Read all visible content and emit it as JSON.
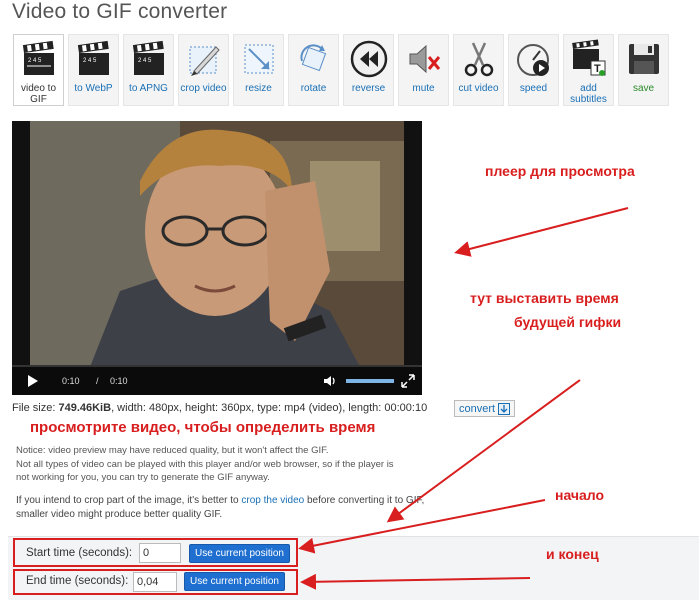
{
  "page": {
    "title": "Video to GIF converter"
  },
  "toolbar": {
    "items": [
      {
        "label": "video to GIF",
        "icon": "clapperboard-icon",
        "active": true
      },
      {
        "label": "to WebP",
        "icon": "clapperboard-icon"
      },
      {
        "label": "to APNG",
        "icon": "clapperboard-icon"
      },
      {
        "label": "crop video",
        "icon": "crop-icon"
      },
      {
        "label": "resize",
        "icon": "resize-icon"
      },
      {
        "label": "rotate",
        "icon": "rotate-icon"
      },
      {
        "label": "reverse",
        "icon": "reverse-icon"
      },
      {
        "label": "mute",
        "icon": "mute-icon"
      },
      {
        "label": "cut video",
        "icon": "scissors-icon"
      },
      {
        "label": "speed",
        "icon": "speed-icon"
      },
      {
        "label": "add subtitles",
        "icon": "subtitles-icon"
      },
      {
        "label": "save",
        "icon": "save-icon"
      }
    ]
  },
  "player": {
    "current_time": "0:10",
    "separator": "/",
    "duration": "0:10"
  },
  "file_info": {
    "prefix": "File size: ",
    "size": "749.46KiB",
    "details": ", width: 480px, height: 360px, type: mp4 (video), length: 00:00:10",
    "convert_label": "convert"
  },
  "notice": {
    "line1": "Notice: video preview may have reduced quality, but it won't affect the GIF.",
    "line2": "Not all types of video can be played with this player and/or web browser, so if the player is",
    "line3": "not working for you, you can try to generate the GIF anyway."
  },
  "crop_hint": {
    "before": "If you intend to crop part of the image, it's better to ",
    "link": "crop the video",
    "after": " before converting it to GIF, smaller video might produce better quality GIF."
  },
  "time_form": {
    "start_label": "Start time (seconds):",
    "start_value": "0",
    "end_label": "End time (seconds):",
    "end_value": "0,04",
    "button_label": "Use current position"
  },
  "annotations": {
    "player": "плеер для просмотра",
    "set_time_1": "тут выставить время",
    "set_time_2": "будущей гифки",
    "watch": "просмотрите видео, чтобы определить время",
    "start": "начало",
    "end": "и конец"
  },
  "colors": {
    "annotation_red": "#d81e1e",
    "link_blue": "#1a6fb5",
    "button_blue": "#1f6fd0"
  }
}
